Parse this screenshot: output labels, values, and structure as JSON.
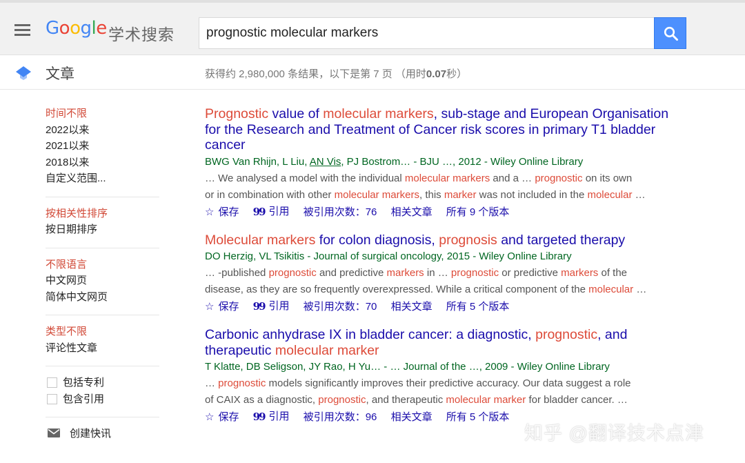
{
  "header": {
    "logo_letters": [
      "G",
      "o",
      "o",
      "g",
      "l",
      "e"
    ],
    "logo_sub": "学术搜索",
    "search_value": "prognostic molecular markers"
  },
  "subheader": {
    "section_title": "文章",
    "stats_prefix": "获得约 2,980,000 条结果，以下是第 7 页 （用时",
    "stats_time": "0.07",
    "stats_suffix": "秒）"
  },
  "sidebar": {
    "time": [
      "时间不限",
      "2022以来",
      "2021以来",
      "2018以来",
      "自定义范围..."
    ],
    "sort": [
      "按相关性排序",
      "按日期排序"
    ],
    "lang": [
      "不限语言",
      "中文网页",
      "简体中文网页"
    ],
    "type": [
      "类型不限",
      "评论性文章"
    ],
    "checks": [
      "包括专利",
      "包含引用"
    ],
    "alert": "创建快讯"
  },
  "results": [
    {
      "title": [
        {
          "t": "Prognostic",
          "hl": true
        },
        {
          "t": " value of ",
          "hl": false
        },
        {
          "t": "molecular markers",
          "hl": true
        },
        {
          "t": ", sub-stage and European Organisation for the Research and Treatment of Cancer risk scores in primary T1 bladder cancer",
          "hl": false
        }
      ],
      "authors": [
        {
          "t": "BWG Van Rhijn, L Liu, ",
          "u": false
        },
        {
          "t": "AN Vis",
          "u": true
        },
        {
          "t": ", PJ Bostrom… - BJU …, 2012 - Wiley Online Library",
          "u": false
        }
      ],
      "snippet": [
        [
          {
            "t": "… We analysed a model with the individual ",
            "hl": false
          },
          {
            "t": "molecular markers",
            "hl": true
          },
          {
            "t": " and a … ",
            "hl": false
          },
          {
            "t": "prognostic",
            "hl": true
          },
          {
            "t": " on its own",
            "hl": false
          }
        ],
        [
          {
            "t": "or in combination with other ",
            "hl": false
          },
          {
            "t": "molecular markers",
            "hl": true
          },
          {
            "t": ", this ",
            "hl": false
          },
          {
            "t": "marker",
            "hl": true
          },
          {
            "t": " was not included in the ",
            "hl": false
          },
          {
            "t": "molecular",
            "hl": true
          },
          {
            "t": " …",
            "hl": false
          }
        ]
      ],
      "save": "保存",
      "cite": "引用",
      "cited_by": "被引用次数：76",
      "related": "相关文章",
      "versions": "所有 9 个版本"
    },
    {
      "title": [
        {
          "t": "Molecular markers",
          "hl": true
        },
        {
          "t": " for colon diagnosis, ",
          "hl": false
        },
        {
          "t": "prognosis",
          "hl": true
        },
        {
          "t": " and targeted therapy",
          "hl": false
        }
      ],
      "authors": [
        {
          "t": "DO Herzig, VL Tsikitis - Journal of surgical oncology, 2015 - Wiley Online Library",
          "u": false
        }
      ],
      "snippet": [
        [
          {
            "t": "… -published ",
            "hl": false
          },
          {
            "t": "prognostic",
            "hl": true
          },
          {
            "t": " and predictive ",
            "hl": false
          },
          {
            "t": "markers",
            "hl": true
          },
          {
            "t": " in … ",
            "hl": false
          },
          {
            "t": "prognostic",
            "hl": true
          },
          {
            "t": " or predictive ",
            "hl": false
          },
          {
            "t": "markers",
            "hl": true
          },
          {
            "t": " of the",
            "hl": false
          }
        ],
        [
          {
            "t": "disease, as they are so frequently overexpressed. While a critical component of the ",
            "hl": false
          },
          {
            "t": "molecular",
            "hl": true
          },
          {
            "t": " …",
            "hl": false
          }
        ]
      ],
      "save": "保存",
      "cite": "引用",
      "cited_by": "被引用次数：70",
      "related": "相关文章",
      "versions": "所有 5 个版本"
    },
    {
      "title": [
        {
          "t": "Carbonic anhydrase IX in bladder cancer: a diagnostic, ",
          "hl": false
        },
        {
          "t": "prognostic",
          "hl": true
        },
        {
          "t": ", and therapeutic ",
          "hl": false
        },
        {
          "t": "molecular marker",
          "hl": true
        }
      ],
      "authors": [
        {
          "t": "T Klatte, DB Seligson, JY Rao, H Yu… - … Journal of the …, 2009 - Wiley Online Library",
          "u": false
        }
      ],
      "snippet": [
        [
          {
            "t": "… ",
            "hl": false
          },
          {
            "t": "prognostic",
            "hl": true
          },
          {
            "t": " models significantly improves their predictive accuracy. Our data suggest a role",
            "hl": false
          }
        ],
        [
          {
            "t": "of CAIX as a diagnostic, ",
            "hl": false
          },
          {
            "t": "prognostic",
            "hl": true
          },
          {
            "t": ", and therapeutic ",
            "hl": false
          },
          {
            "t": "molecular marker",
            "hl": true
          },
          {
            "t": " for bladder cancer. …",
            "hl": false
          }
        ]
      ],
      "save": "保存",
      "cite": "引用",
      "cited_by": "被引用次数：96",
      "related": "相关文章",
      "versions": "所有 5 个版本"
    }
  ],
  "watermark": "知乎 @翻译技术点津",
  "colors": {
    "link": "#1a0dab",
    "highlight": "#dd4b39",
    "sidebar_active": "#d14836",
    "source_green": "#006621",
    "search_button": "#4d90fe"
  }
}
